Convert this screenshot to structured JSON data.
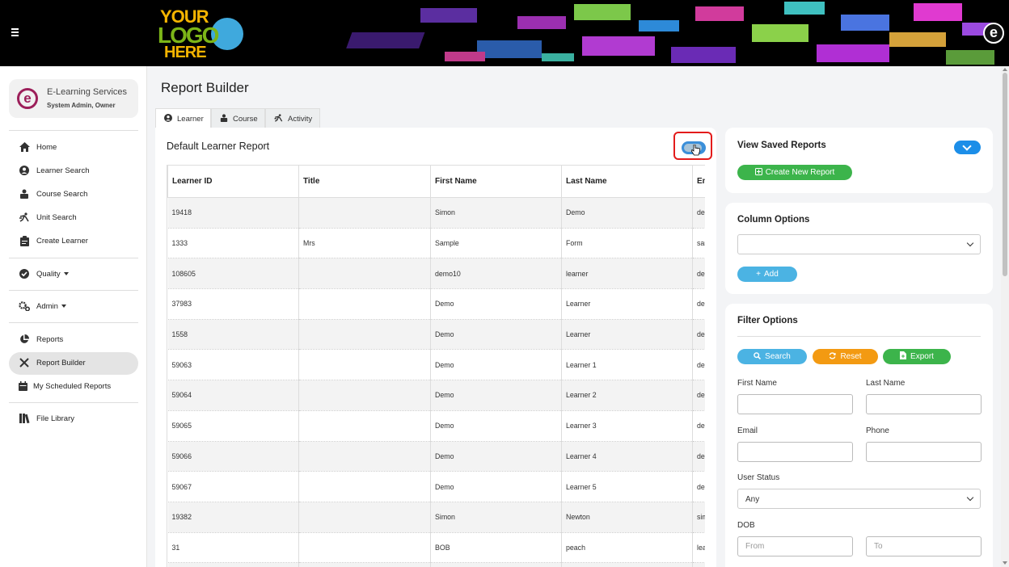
{
  "header": {
    "logo": {
      "line1": "YOUR",
      "line2": "LOGO",
      "line3": "HERE"
    },
    "brand_icon": "e-logo-icon"
  },
  "sidebar": {
    "org_name": "E-Learning Services",
    "org_role": "System Admin, Owner",
    "items": [
      {
        "label": "Home",
        "icon": "home-icon"
      },
      {
        "label": "Learner Search",
        "icon": "user-circle-icon"
      },
      {
        "label": "Course Search",
        "icon": "course-icon"
      },
      {
        "label": "Unit Search",
        "icon": "unit-icon"
      },
      {
        "label": "Create Learner",
        "icon": "clipboard-icon"
      },
      {
        "label": "Quality",
        "icon": "check-circle-icon"
      },
      {
        "label": "Admin",
        "icon": "cogs-icon"
      },
      {
        "label": "Reports",
        "icon": "pie-chart-icon"
      },
      {
        "label": "Report Builder",
        "icon": "tools-icon"
      },
      {
        "label": "My Scheduled Reports",
        "icon": "calendar-icon"
      },
      {
        "label": "File Library",
        "icon": "books-icon"
      }
    ]
  },
  "main": {
    "page_title": "Report Builder",
    "tabs": [
      {
        "label": "Learner",
        "icon": "user-circle-icon"
      },
      {
        "label": "Course",
        "icon": "course-icon"
      },
      {
        "label": "Activity",
        "icon": "unit-icon"
      }
    ],
    "report_title": "Default Learner Report",
    "table": {
      "columns": [
        "Learner ID",
        "Title",
        "First Name",
        "Last Name",
        "Em"
      ],
      "rows": [
        [
          "19418",
          "",
          "Simon",
          "Demo",
          "der"
        ],
        [
          "1333",
          "Mrs",
          "Sample",
          "Form",
          "sar"
        ],
        [
          "108605",
          "",
          "demo10",
          "learner",
          "der"
        ],
        [
          "37983",
          "",
          "Demo",
          "Learner",
          "der"
        ],
        [
          "1558",
          "",
          "Demo",
          "Learner",
          "der"
        ],
        [
          "59063",
          "",
          "Demo",
          "Learner 1",
          "der"
        ],
        [
          "59064",
          "",
          "Demo",
          "Learner 2",
          "der"
        ],
        [
          "59065",
          "",
          "Demo",
          "Learner 3",
          "der"
        ],
        [
          "59066",
          "",
          "Demo",
          "Learner 4",
          "der"
        ],
        [
          "59067",
          "",
          "Demo",
          "Learner 5",
          "der"
        ],
        [
          "19382",
          "",
          "Simon",
          "Newton",
          "sim"
        ],
        [
          "31",
          "",
          "BOB",
          "peach",
          "lea"
        ],
        [
          "",
          "",
          "",
          "",
          ""
        ]
      ]
    }
  },
  "saved_reports": {
    "title": "View Saved Reports",
    "create_label": "Create New Report"
  },
  "column_options": {
    "title": "Column Options",
    "select_value": "",
    "add_label": "Add"
  },
  "filter_options": {
    "title": "Filter Options",
    "search_label": "Search",
    "reset_label": "Reset",
    "export_label": "Export",
    "first_name_label": "First Name",
    "last_name_label": "Last Name",
    "email_label": "Email",
    "phone_label": "Phone",
    "user_status_label": "User Status",
    "user_status_value": "Any",
    "dob_label": "DOB",
    "dob_from_placeholder": "From",
    "dob_to_placeholder": "To"
  },
  "colors": {
    "accent_blue": "#1c8ee8",
    "green": "#3cb44b",
    "light_blue": "#4bb3e3",
    "orange": "#f39a12",
    "highlight_red": "#e31b1b",
    "brand_magenta": "#9c1f5a"
  }
}
